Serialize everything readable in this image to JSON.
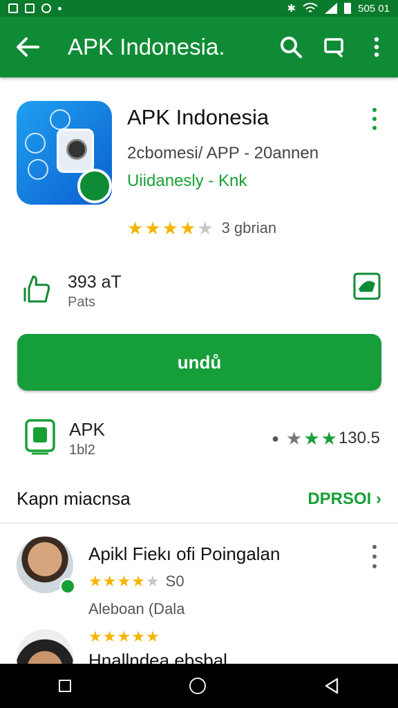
{
  "status_bar": {
    "time": "505 01"
  },
  "app_bar": {
    "title": "APK Indonesia."
  },
  "app": {
    "name": "APK Indonesia",
    "subtitle": "2cbomesi/ APP - 20annen",
    "developer": "Uiidanesly - Knk",
    "rating_stars": 4,
    "rating_label": "3 gbrian"
  },
  "info": {
    "value": "393 аT",
    "label": "Pats"
  },
  "install_button": {
    "label": "undů"
  },
  "apk": {
    "title": "APK",
    "subtitle": "1bl2",
    "rating_text": "130.5"
  },
  "reviews_section": {
    "title": "Kapn miacnsa",
    "link": "DPRSOI"
  },
  "reviews": [
    {
      "name": "Apikl Fiekı ofi Poingalan",
      "stars": 4,
      "score": "S0",
      "meta": "Aleboan (Dala"
    },
    {
      "name": "Hnallndea ebsbal",
      "stars": 5,
      "score": "",
      "meta": ""
    }
  ],
  "colors": {
    "primary": "#0f8b35",
    "accent": "#17a035",
    "star": "#f4b400",
    "star_empty": "#c6c6c6"
  },
  "icons": {
    "back": "arrow-left-icon",
    "search": "search-icon",
    "share": "cast-icon",
    "menu": "more-vertical-icon",
    "thumbs": "thumbs-up-icon",
    "badge": "award-icon",
    "apk": "apk-icon",
    "nav_recents": "square-icon",
    "nav_home": "circle-icon",
    "nav_back": "triangle-icon"
  }
}
